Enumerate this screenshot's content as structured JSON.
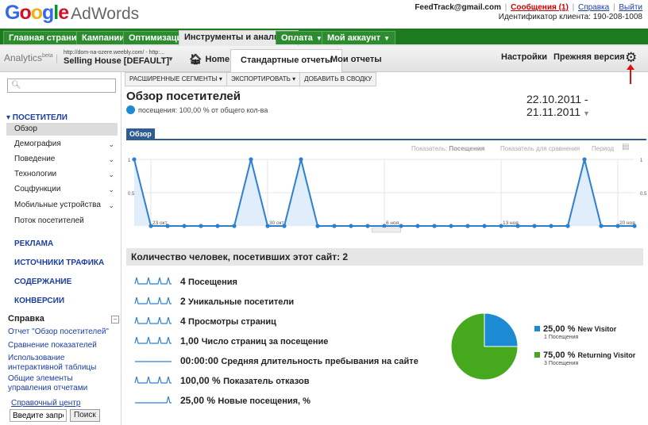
{
  "header": {
    "logo_google": "Google",
    "logo_product": "AdWords",
    "email": "FeedTrack@gmail.com",
    "messages": "Сообщения (1)",
    "help": "Справка",
    "logout": "Выйти",
    "client_id": "Идентификатор клиента: 190-208-1008"
  },
  "topnav": {
    "items": [
      {
        "label": "Главная страница"
      },
      {
        "label": "Кампании"
      },
      {
        "label": "Оптимизация"
      },
      {
        "label": "Инструменты и анализ"
      },
      {
        "label": "Оплата"
      },
      {
        "label": "Мой аккаунт"
      }
    ]
  },
  "analytics_bar": {
    "brand": "Analytics",
    "brand_sup": "beta",
    "profile_url": "http://dom-na-ozere.weebly.com/ - http:...",
    "profile_name": "Selling House [DEFAULT]",
    "tab_home": "Home",
    "tab_standard": "Стандартные отчеты",
    "tab_my": "Мои отчеты",
    "settings": "Настройки",
    "old_version": "Прежняя версия"
  },
  "sidebar": {
    "search_placeholder": "",
    "visitors_head": "▾ ПОСЕТИТЕЛИ",
    "items": [
      {
        "label": "Обзор"
      },
      {
        "label": "Демография"
      },
      {
        "label": "Поведение"
      },
      {
        "label": "Технологии"
      },
      {
        "label": "Соцфункции"
      },
      {
        "label": "Мобильные устройства"
      },
      {
        "label": "Поток посетителей"
      }
    ],
    "sections": [
      "РЕКЛАМА",
      "ИСТОЧНИКИ ТРАФИКА",
      "СОДЕРЖАНИЕ",
      "КОНВЕРСИИ"
    ],
    "help_head": "Справка",
    "help_links": [
      "Отчет \"Обзор посетителей\"",
      "Сравнение показателей",
      "Использование интерактивной таблицы",
      "Общие элементы управления отчетами"
    ],
    "help_center": "Справочный центр",
    "help_search_value": "Введите запрос",
    "help_search_button": "Поиск"
  },
  "main": {
    "toolbar": [
      "РАСШИРЕННЫЕ СЕГМЕНТЫ ▾",
      "ЭКСПОРТИРОВАТЬ ▾",
      "ДОБАВИТЬ В СВОДКУ"
    ],
    "title": "Обзор посетителей",
    "subtitle": "посещения: 100,00 % от общего кол-ва",
    "date_start": "22.10.2011",
    "date_sep": " - ",
    "date_end": "21.11.2011",
    "overview_tab": "Обзор",
    "chart_controls": {
      "show_label": "Показатель:",
      "show_value": "Посещения",
      "compare": "Показатель для сравнения",
      "period": "Период"
    },
    "visitors_bar": "Количество человек, посетивших этот сайт: 2",
    "metrics": [
      {
        "value": "4",
        "name": "Посещения"
      },
      {
        "value": "2",
        "name": "Уникальные посетители"
      },
      {
        "value": "4",
        "name": "Просмотры страниц"
      },
      {
        "value": "1,00",
        "name": "Число страниц за посещение"
      },
      {
        "value": "00:00:00",
        "name": "Средняя длительность пребывания на сайте"
      },
      {
        "value": "100,00 %",
        "name": "Показатель отказов"
      },
      {
        "value": "25,00 %",
        "name": "Новые посещения, %"
      }
    ],
    "legend": [
      {
        "pct": "25,00 %",
        "name": "New Visitor",
        "sub": "1 Посещения",
        "color": "#1d8bd4"
      },
      {
        "pct": "75,00 %",
        "name": "Returning Visitor",
        "sub": "3 Посещения",
        "color": "#45a81d"
      }
    ]
  },
  "chart_data": [
    {
      "type": "area",
      "x": [
        "22.10",
        "23.10",
        "24.10",
        "25.10",
        "26.10",
        "27.10",
        "28.10",
        "29.10",
        "30.10",
        "31.10",
        "01.11",
        "02.11",
        "03.11",
        "04.11",
        "05.11",
        "06.11",
        "07.11",
        "08.11",
        "09.11",
        "10.11",
        "11.11",
        "12.11",
        "13.11",
        "14.11",
        "15.11",
        "16.11",
        "17.11",
        "18.11",
        "19.11",
        "20.11",
        "21.11"
      ],
      "xtick_labels": [
        "23 окт",
        "30 окт",
        "6 ноя",
        "13 ноя",
        "20 ноя"
      ],
      "xtick_index": [
        1,
        8,
        15,
        22,
        29
      ],
      "series": [
        {
          "values": [
            1,
            0,
            0,
            0,
            0,
            0,
            0,
            1,
            0,
            0,
            1,
            0,
            0,
            0,
            0,
            0,
            0,
            0,
            0,
            0,
            0,
            0,
            0,
            0,
            0,
            0,
            0,
            1,
            0,
            0,
            0
          ]
        }
      ],
      "ylim": [
        0,
        1
      ],
      "yticks": [
        "1",
        "0.5"
      ],
      "color": "#2f7fd1",
      "grid": true
    },
    {
      "type": "pie",
      "categories": [
        "New Visitor",
        "Returning Visitor"
      ],
      "values": [
        25,
        75
      ],
      "colors": [
        "#1d8bd4",
        "#45a81d"
      ]
    }
  ]
}
